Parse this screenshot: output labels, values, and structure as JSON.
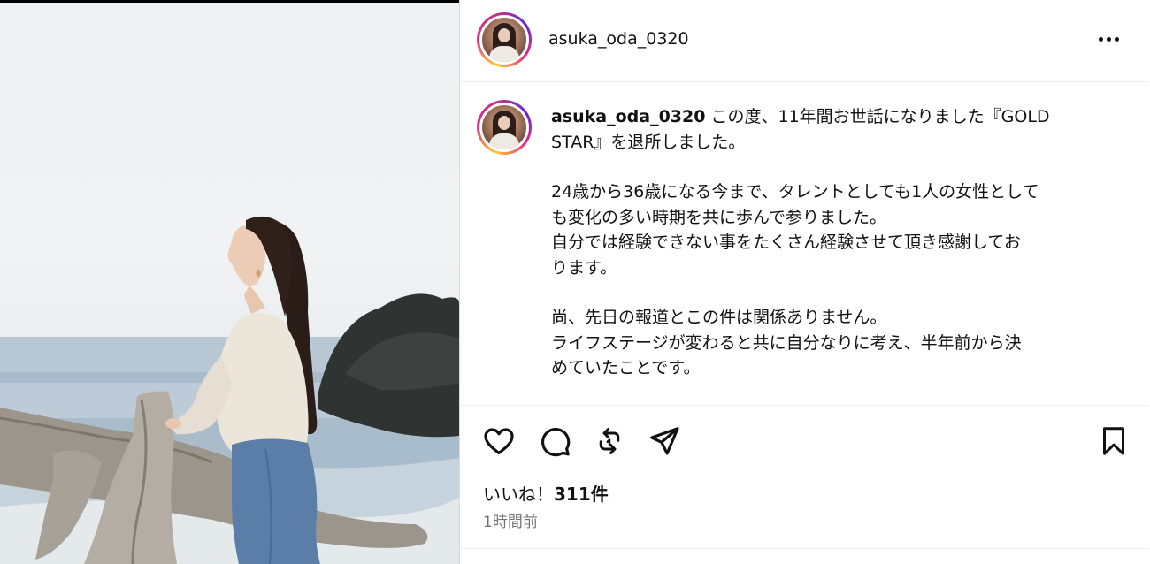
{
  "post": {
    "username": "asuka_oda_0320",
    "caption_user": "asuka_oda_0320",
    "caption_lines": [
      "この度、11年間お世話になりました『GOLD",
      "STAR』を退所しました。",
      "",
      "24歳から36歳になる今まで、タレントとしても1人の女性として",
      "も変化の多い時期を共に歩んで参りました。",
      "自分では経験できない事をたくさん経験させて頂き感謝してお",
      "ります。",
      "",
      "尚、先日の報道とこの件は関係ありません。",
      "ライフステージが変わると共に自分なりに考え、半年前から決",
      "めていたことです。"
    ],
    "likes_prefix": "いいね！",
    "likes_count": "311件",
    "timestamp": "1時間前"
  },
  "icons": {
    "more": "more-options-icon",
    "like": "heart-icon",
    "comment": "comment-icon",
    "repost": "repost-icon",
    "share": "send-icon",
    "save": "bookmark-icon"
  },
  "colors": {
    "ring_start": "#f9ce34",
    "ring_mid": "#ee2a7b",
    "ring_end": "#6228d7",
    "timestamp": "#737373"
  }
}
